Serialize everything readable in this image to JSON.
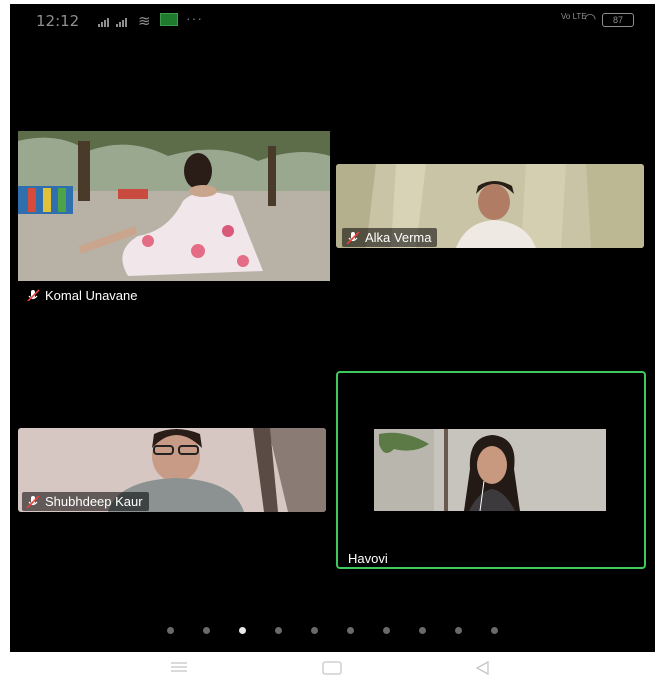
{
  "status_bar": {
    "time": "12:12",
    "network_label": "Vo LTE",
    "battery": "87"
  },
  "participants": [
    {
      "name": "Komal Unavane",
      "muted": true
    },
    {
      "name": "Alka Verma",
      "muted": true
    },
    {
      "name": "Shubhdeep Kaur",
      "muted": true
    },
    {
      "name": "Havovi",
      "muted": false,
      "active_speaker": true
    }
  ],
  "pager": {
    "pages": 10,
    "current": 3
  },
  "colors": {
    "active_speaker_border": "#3ec95c",
    "background": "#000000"
  },
  "icons": [
    "signal-icon",
    "wifi-icon",
    "headset-icon",
    "battery-icon",
    "muted-mic-icon",
    "menu-icon",
    "home-icon",
    "back-icon"
  ]
}
